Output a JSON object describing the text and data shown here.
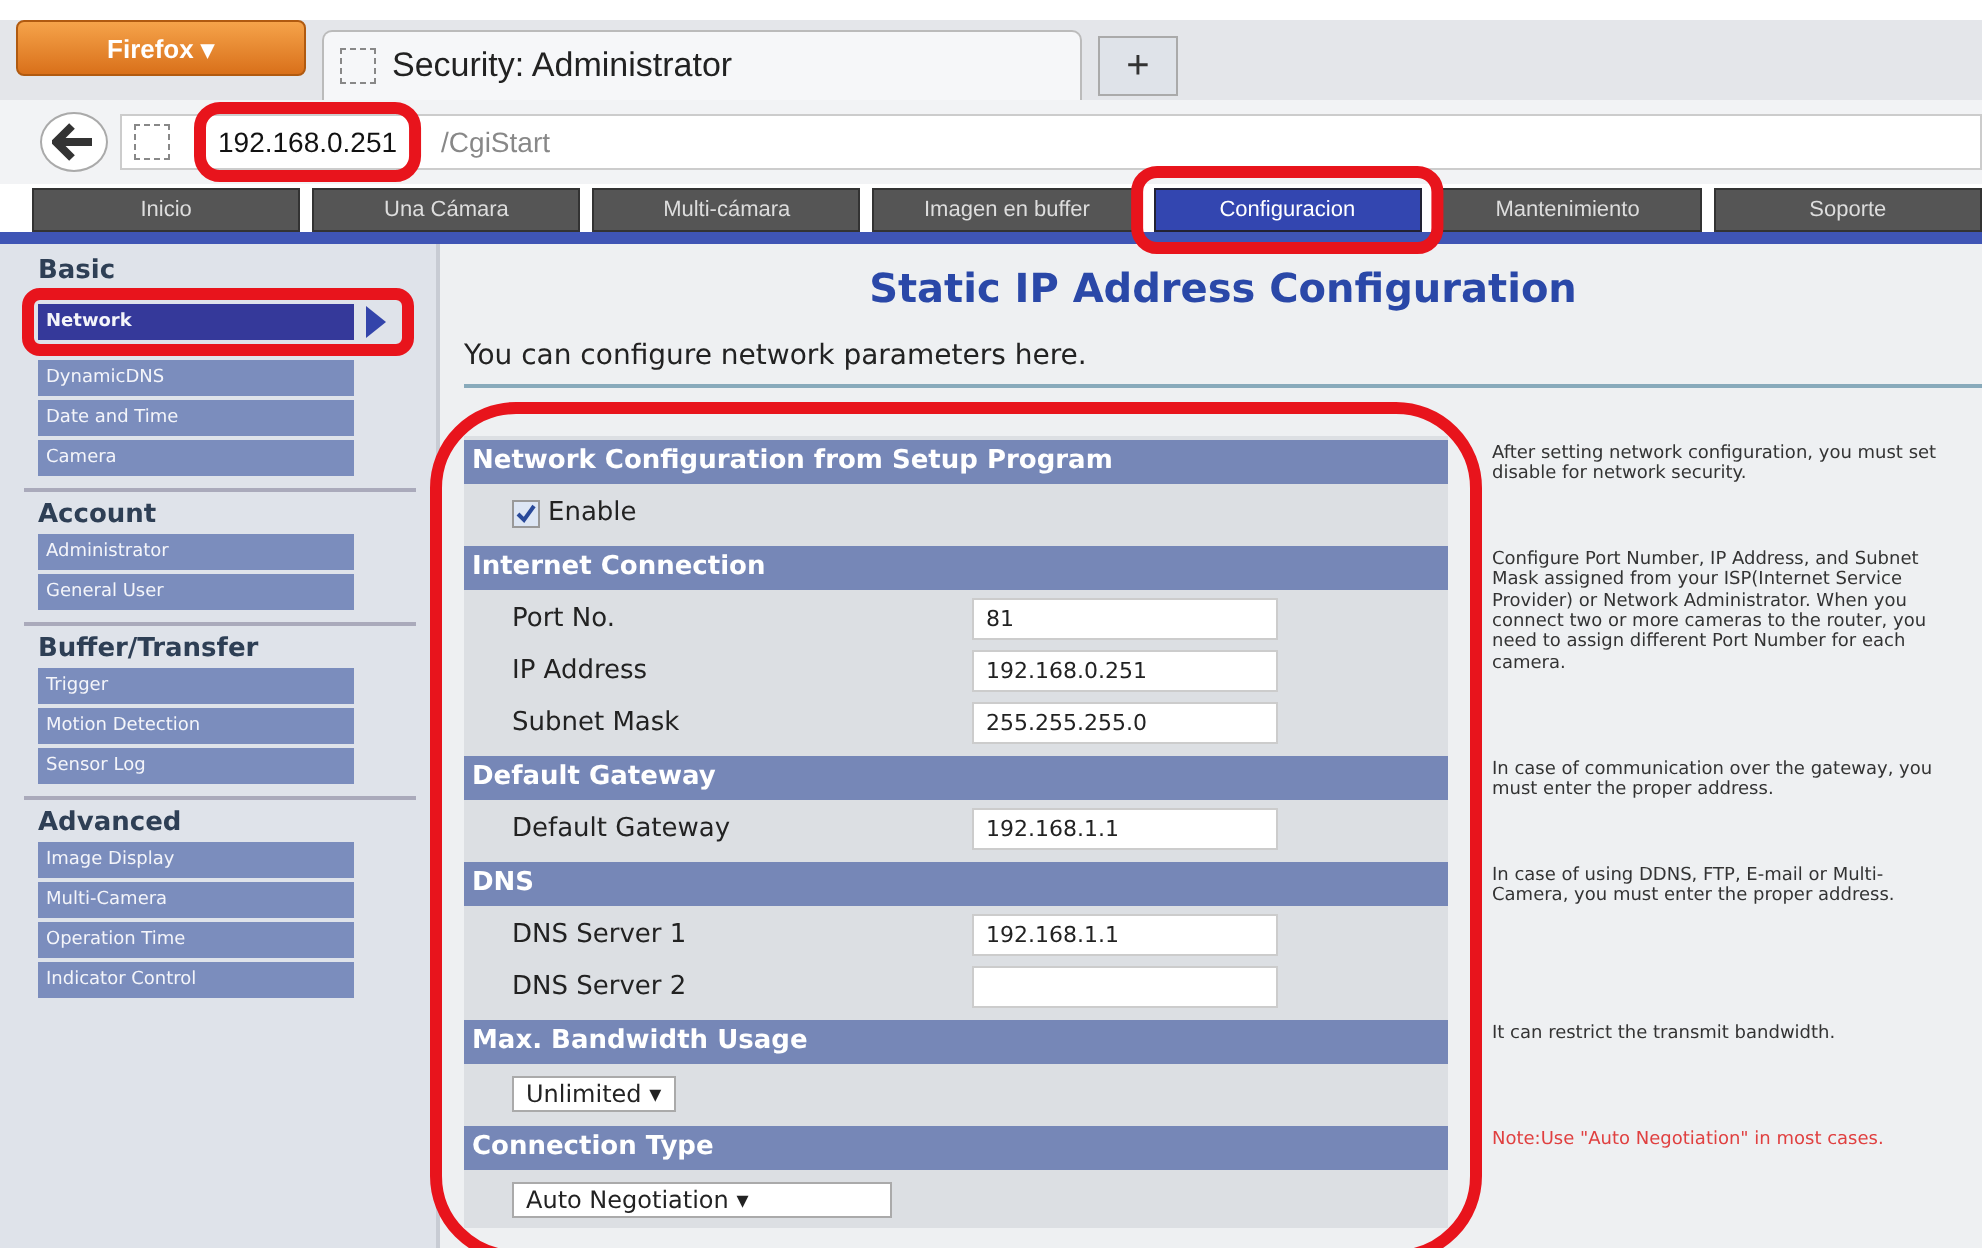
{
  "browser": {
    "menu_button": "Firefox ▾",
    "tab_title": "Security: Administrator",
    "new_tab": "+",
    "url_host": "192.168.0.251",
    "url_path": "/CgiStart"
  },
  "nav_tabs": [
    {
      "label": "Inicio",
      "selected": false
    },
    {
      "label": "Una Cámara",
      "selected": false
    },
    {
      "label": "Multi-cámara",
      "selected": false
    },
    {
      "label": "Imagen en buffer",
      "selected": false
    },
    {
      "label": "Configuracion",
      "selected": true
    },
    {
      "label": "Mantenimiento",
      "selected": false
    },
    {
      "label": "Soporte",
      "selected": false
    }
  ],
  "sidebar": [
    {
      "heading": "Basic",
      "items": [
        {
          "label": "Network",
          "selected": true
        },
        {
          "label": "DynamicDNS",
          "selected": false
        },
        {
          "label": "Date and Time",
          "selected": false
        },
        {
          "label": "Camera",
          "selected": false
        }
      ]
    },
    {
      "heading": "Account",
      "items": [
        {
          "label": "Administrator",
          "selected": false
        },
        {
          "label": "General User",
          "selected": false
        }
      ]
    },
    {
      "heading": "Buffer/Transfer",
      "items": [
        {
          "label": "Trigger",
          "selected": false
        },
        {
          "label": "Motion Detection",
          "selected": false
        },
        {
          "label": "Sensor Log",
          "selected": false
        }
      ]
    },
    {
      "heading": "Advanced",
      "items": [
        {
          "label": "Image Display",
          "selected": false
        },
        {
          "label": "Multi-Camera",
          "selected": false
        },
        {
          "label": "Operation Time",
          "selected": false
        },
        {
          "label": "Indicator Control",
          "selected": false
        }
      ]
    }
  ],
  "page_title": "Static IP Address Configuration",
  "intro": "You can configure network parameters here.",
  "sections": [
    {
      "title": "Network Configuration from Setup Program",
      "help": "After setting network configuration, you must set disable for network security.",
      "note": false,
      "rows": [
        {
          "kind": "checkbox",
          "label": "Enable",
          "checked": true
        }
      ]
    },
    {
      "title": "Internet Connection",
      "help": "Configure Port Number, IP Address, and Subnet Mask assigned from your ISP(Internet Service Provider) or Network Administrator. When you connect two or more cameras to the router, you need to assign different Port Number for each camera.",
      "note": false,
      "rows": [
        {
          "kind": "field",
          "label": "Port No.",
          "value": "81"
        },
        {
          "kind": "field",
          "label": "IP Address",
          "value": "192.168.0.251"
        },
        {
          "kind": "field",
          "label": "Subnet Mask",
          "value": "255.255.255.0"
        }
      ]
    },
    {
      "title": "Default Gateway",
      "help": "In case of communication over the gateway, you must enter the proper address.",
      "note": false,
      "rows": [
        {
          "kind": "field",
          "label": "Default Gateway",
          "value": "192.168.1.1"
        }
      ]
    },
    {
      "title": "DNS",
      "help": "In case of using DDNS, FTP, E-mail or Multi-Camera, you must enter the proper address.",
      "note": false,
      "rows": [
        {
          "kind": "field",
          "label": "DNS Server 1",
          "value": "192.168.1.1"
        },
        {
          "kind": "field",
          "label": "DNS Server 2"
        }
      ]
    },
    {
      "title": "Max. Bandwidth Usage",
      "help": "It can restrict the transmit bandwidth.",
      "note": false,
      "rows": [
        {
          "kind": "select",
          "value": "Unlimited ▾",
          "wide": false
        }
      ]
    },
    {
      "title": "Connection Type",
      "help": "Note:Use \"Auto Negotiation\" in most cases.",
      "note": true,
      "rows": [
        {
          "kind": "select",
          "value": "Auto Negotiation ▾",
          "wide": true
        }
      ]
    }
  ],
  "highlight_frames": {
    "address": true,
    "config_tab": true,
    "network_item": true,
    "form": true
  }
}
